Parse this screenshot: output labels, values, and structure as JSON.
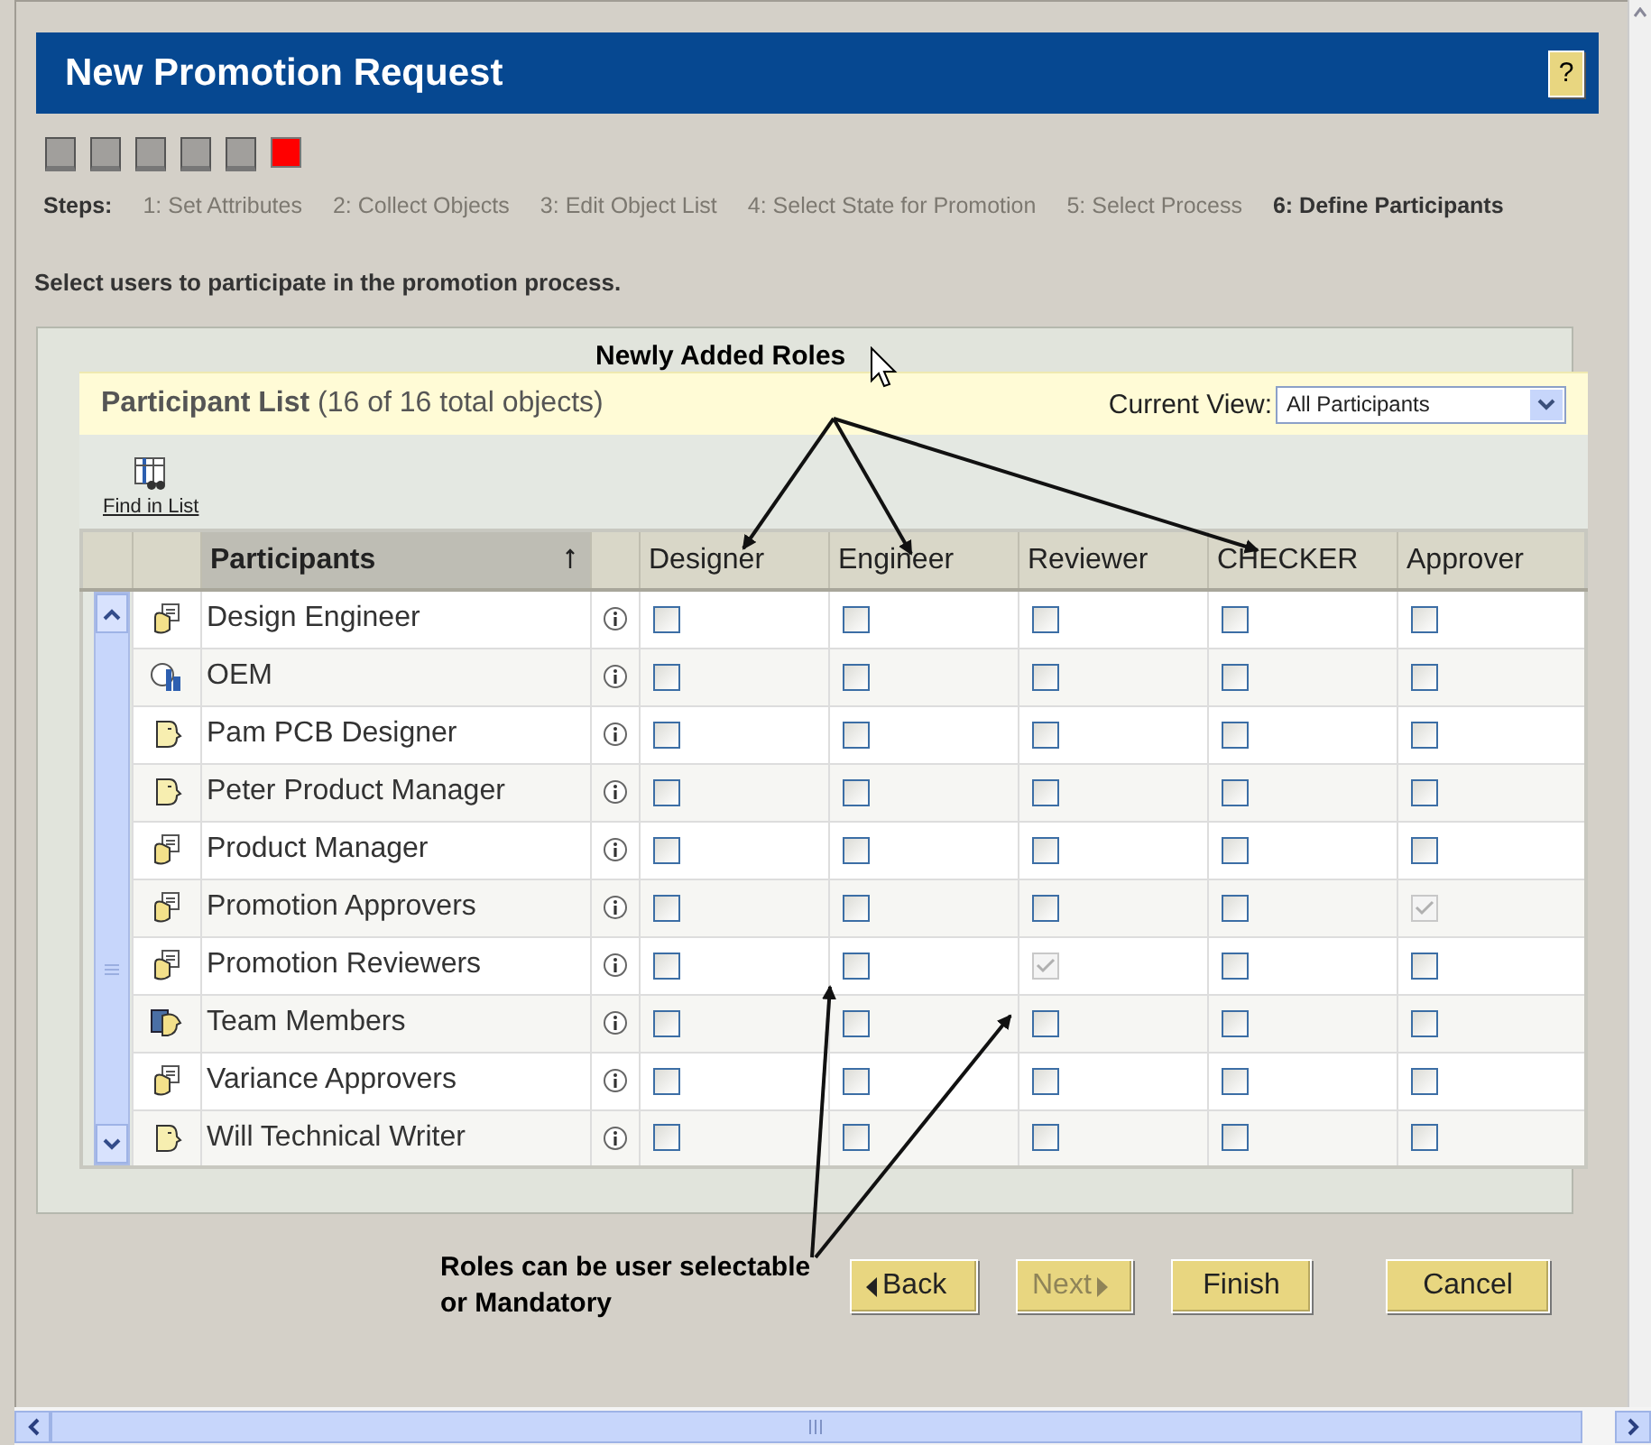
{
  "window": {
    "title": "New Promotion Request",
    "help": "?"
  },
  "steps": {
    "label": "Steps:",
    "items": [
      {
        "label": "1: Set Attributes",
        "selected": false
      },
      {
        "label": "2: Collect Objects",
        "selected": false
      },
      {
        "label": "3: Edit Object List",
        "selected": false
      },
      {
        "label": "4: Select State for Promotion",
        "selected": false
      },
      {
        "label": "5: Select Process",
        "selected": false
      },
      {
        "label": "6: Define Participants",
        "selected": true
      }
    ]
  },
  "instruction": "Select users to participate in the promotion process.",
  "panel": {
    "title": "Participant List",
    "count": "(16 of 16 total objects)",
    "view_label": "Current View:",
    "view_value": "All Participants",
    "find_label": "Find in List"
  },
  "table": {
    "columns": [
      "Participants",
      "Designer",
      "Engineer",
      "Reviewer",
      "CHECKER",
      "Approver"
    ],
    "rows": [
      {
        "name": "Design Engineer",
        "kind": "group",
        "roles": [
          {
            "checked": false,
            "disabled": false
          },
          {
            "checked": false,
            "disabled": false
          },
          {
            "checked": false,
            "disabled": false
          },
          {
            "checked": false,
            "disabled": false
          },
          {
            "checked": false,
            "disabled": false
          }
        ]
      },
      {
        "name": "OEM",
        "kind": "org",
        "roles": [
          {
            "checked": false,
            "disabled": false
          },
          {
            "checked": false,
            "disabled": false
          },
          {
            "checked": false,
            "disabled": false
          },
          {
            "checked": false,
            "disabled": false
          },
          {
            "checked": false,
            "disabled": false
          }
        ]
      },
      {
        "name": "Pam PCB Designer",
        "kind": "user",
        "roles": [
          {
            "checked": false,
            "disabled": false
          },
          {
            "checked": false,
            "disabled": false
          },
          {
            "checked": false,
            "disabled": false
          },
          {
            "checked": false,
            "disabled": false
          },
          {
            "checked": false,
            "disabled": false
          }
        ]
      },
      {
        "name": "Peter Product Manager",
        "kind": "user",
        "roles": [
          {
            "checked": false,
            "disabled": false
          },
          {
            "checked": false,
            "disabled": false
          },
          {
            "checked": false,
            "disabled": false
          },
          {
            "checked": false,
            "disabled": false
          },
          {
            "checked": false,
            "disabled": false
          }
        ]
      },
      {
        "name": "Product Manager",
        "kind": "group",
        "roles": [
          {
            "checked": false,
            "disabled": false
          },
          {
            "checked": false,
            "disabled": false
          },
          {
            "checked": false,
            "disabled": false
          },
          {
            "checked": false,
            "disabled": false
          },
          {
            "checked": false,
            "disabled": false
          }
        ]
      },
      {
        "name": "Promotion Approvers",
        "kind": "group",
        "roles": [
          {
            "checked": false,
            "disabled": false
          },
          {
            "checked": false,
            "disabled": false
          },
          {
            "checked": false,
            "disabled": false
          },
          {
            "checked": false,
            "disabled": false
          },
          {
            "checked": true,
            "disabled": true
          }
        ]
      },
      {
        "name": "Promotion Reviewers",
        "kind": "group",
        "roles": [
          {
            "checked": false,
            "disabled": false
          },
          {
            "checked": false,
            "disabled": false
          },
          {
            "checked": true,
            "disabled": true
          },
          {
            "checked": false,
            "disabled": false
          },
          {
            "checked": false,
            "disabled": false
          }
        ]
      },
      {
        "name": "Team Members",
        "kind": "team",
        "roles": [
          {
            "checked": false,
            "disabled": false
          },
          {
            "checked": false,
            "disabled": false
          },
          {
            "checked": false,
            "disabled": false
          },
          {
            "checked": false,
            "disabled": false
          },
          {
            "checked": false,
            "disabled": false
          }
        ]
      },
      {
        "name": "Variance Approvers",
        "kind": "group",
        "roles": [
          {
            "checked": false,
            "disabled": false
          },
          {
            "checked": false,
            "disabled": false
          },
          {
            "checked": false,
            "disabled": false
          },
          {
            "checked": false,
            "disabled": false
          },
          {
            "checked": false,
            "disabled": false
          }
        ]
      },
      {
        "name": "Will Technical Writer",
        "kind": "user",
        "roles": [
          {
            "checked": false,
            "disabled": false
          },
          {
            "checked": false,
            "disabled": false
          },
          {
            "checked": false,
            "disabled": false
          },
          {
            "checked": false,
            "disabled": false
          },
          {
            "checked": false,
            "disabled": false
          }
        ]
      }
    ]
  },
  "annotations": {
    "roles_note": "Newly Added Roles",
    "mandatory_note": "Roles can be user selectable or Mandatory"
  },
  "buttons": [
    {
      "label": "Back",
      "kind": "back",
      "disabled": false
    },
    {
      "label": "Next",
      "kind": "next",
      "disabled": true
    },
    {
      "label": "Finish",
      "kind": "plain",
      "disabled": false
    },
    {
      "label": "Cancel",
      "kind": "cancel",
      "disabled": false
    }
  ]
}
